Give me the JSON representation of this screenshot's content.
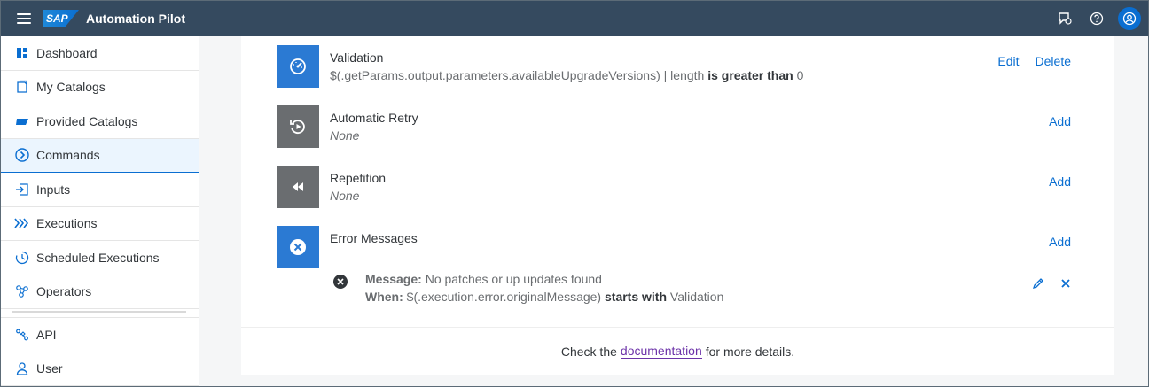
{
  "app": {
    "logo": "SAP",
    "title": "Automation Pilot"
  },
  "shell_icons": [
    "feedback-icon",
    "help-icon",
    "user-avatar-icon"
  ],
  "sidebar": {
    "items": [
      {
        "label": "Dashboard",
        "icon": "dashboard-icon"
      },
      {
        "label": "My Catalogs",
        "icon": "catalog-icon"
      },
      {
        "label": "Provided Catalogs",
        "icon": "provided-catalog-icon"
      },
      {
        "label": "Commands",
        "icon": "command-icon",
        "selected": true
      },
      {
        "label": "Inputs",
        "icon": "input-icon"
      },
      {
        "label": "Executions",
        "icon": "executions-icon"
      },
      {
        "label": "Scheduled Executions",
        "icon": "scheduled-icon"
      },
      {
        "label": "Operators",
        "icon": "operators-icon"
      }
    ],
    "bottom_items": [
      {
        "label": "API",
        "icon": "api-icon"
      },
      {
        "label": "User",
        "icon": "user-icon"
      }
    ]
  },
  "rows": {
    "validation": {
      "title": "Validation",
      "expr": "$(.getParams.output.parameters.availableUpgradeVersions) | length",
      "operator": "is greater than",
      "value": "0",
      "edit": "Edit",
      "delete": "Delete"
    },
    "retry": {
      "title": "Automatic Retry",
      "sub": "None",
      "add": "Add"
    },
    "repetition": {
      "title": "Repetition",
      "sub": "None",
      "add": "Add"
    },
    "errors": {
      "title": "Error Messages",
      "add": "Add",
      "message_label": "Message:",
      "message_value": "No patches or up updates found",
      "when_label": "When:",
      "when_expr": "$(.execution.error.originalMessage)",
      "when_op": "starts with",
      "when_value": "Validation"
    }
  },
  "footer": {
    "before": "Check the",
    "link": "documentation",
    "after": "for more details."
  },
  "colors": {
    "shell": "#354a5f",
    "accent": "#0a6ed1",
    "tile_blue": "#2b7ad3",
    "tile_grey": "#6a6d70"
  }
}
